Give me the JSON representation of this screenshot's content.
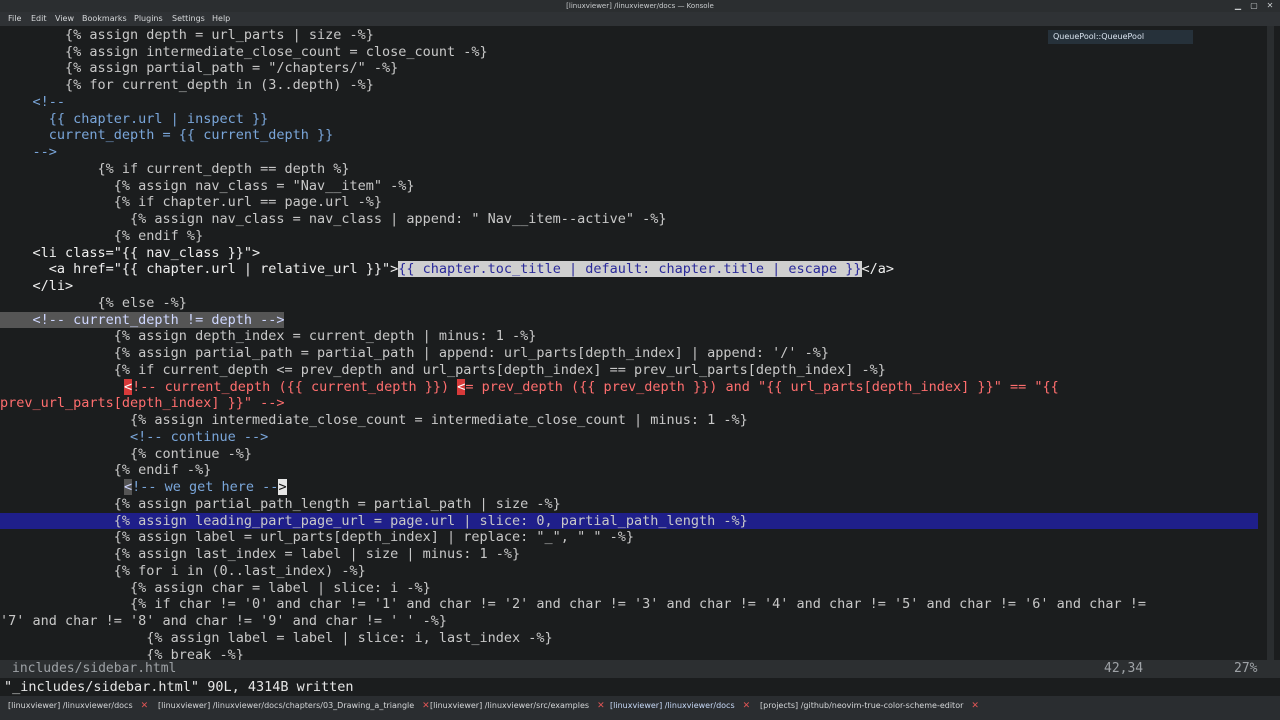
{
  "window": {
    "title": "[linuxviewer] /linuxviewer/docs — Konsole",
    "min": "▁",
    "max": "▢",
    "close": "✕"
  },
  "menu": [
    "File",
    "Edit",
    "View",
    "Bookmarks",
    "Plugins",
    "Settings",
    "Help"
  ],
  "tooltip": "QueuePool::QueuePool",
  "status": {
    "file": "includes/sidebar.html",
    "position": "42,34",
    "percent": "27%"
  },
  "cmdline": "\"_includes/sidebar.html\" 90L, 4314B written",
  "tabs": [
    {
      "label": "[linuxviewer] /linuxviewer/docs"
    },
    {
      "label": "[linuxviewer] /linuxviewer/docs/chapters/03_Drawing_a_triangle"
    },
    {
      "label": "[linuxviewer] /linuxviewer/src/examples"
    },
    {
      "label": "[linuxviewer] /linuxviewer/docs"
    },
    {
      "label": "[projects] /github/neovim-true-color-scheme-editor"
    }
  ],
  "code": [
    "        {% assign depth = url_parts | size -%}",
    "        {% assign intermediate_close_count = close_count -%}",
    "        {% assign partial_path = \"/chapters/\" -%}",
    "        {% for current_depth in (3..depth) -%}",
    "    <!--",
    "      {{ chapter.url | inspect }}",
    "      current_depth = {{ current_depth }}",
    "    -->",
    "            {% if current_depth == depth %}",
    "              {% assign nav_class = \"Nav__item\" -%}",
    "              {% if chapter.url == page.url -%}",
    "                {% assign nav_class = nav_class | append: \" Nav__item--active\" -%}",
    "              {% endif %}",
    "    <li class=\"{{ nav_class }}\">",
    "      <a href=\"{{ chapter.url | relative_url }}\">",
    "{{ chapter.toc_title | default: chapter.title | escape }}",
    "</a>",
    "    </li>",
    "            {% else -%}",
    "    <!-- current_depth != depth -->",
    "              {% assign depth_index = current_depth | minus: 1 -%}",
    "              {% assign partial_path = partial_path | append: url_parts[depth_index] | append: '/' -%}",
    "              {% if current_depth <= prev_depth and url_parts[depth_index] == prev_url_parts[depth_index] -%}",
    "<",
    "!-- current_depth ({{ current_depth }}) ",
    "<",
    "= prev_depth ({{ prev_depth }}) and \"{{ url_parts[depth_index] }}\" == \"{{",
    "prev_url_parts[depth_index] }}\" -->",
    "                {% assign intermediate_close_count = intermediate_close_count | minus: 1 -%}",
    "                <!-- continue -->",
    "                {% continue -%}",
    "              {% endif -%}",
    "<",
    "!-- we get here --",
    ">",
    "              {% assign partial_path_length = partial_path | size -%}",
    "              {% assign leading_part_page_url = page.url | slice: 0, partial_path_length -%}",
    "              {% assign label = url_parts[depth_index] | replace: \"_\", \" \" -%}",
    "              {% assign last_index = label | size | minus: 1 -%}",
    "              {% for i in (0..last_index) -%}",
    "                {% assign char = label | slice: i -%}",
    "                {% if char != '0' and char != '1' and char != '2' and char != '3' and char != '4' and char != '5' and char != '6' and char !=",
    "'7' and char != '8' and char != '9' and char != ' ' -%}",
    "                  {% assign label = label | slice: i, last_index -%}",
    "                  {% break -%}"
  ]
}
